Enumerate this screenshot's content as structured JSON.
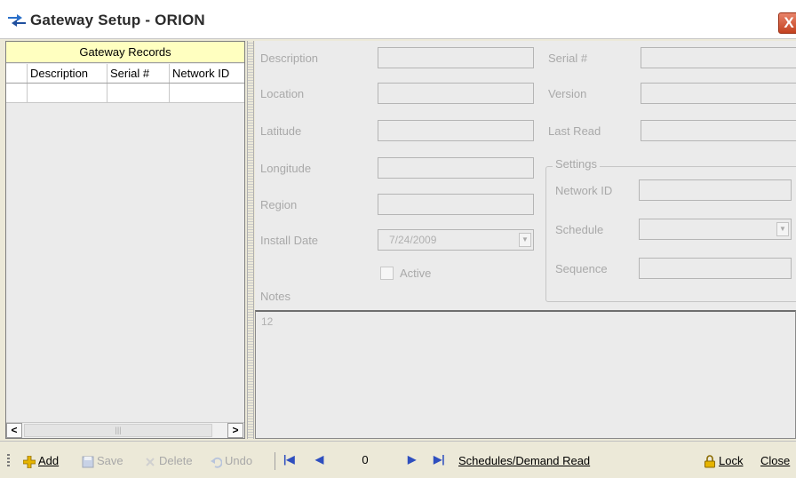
{
  "window": {
    "title": "Gateway Setup - ORION",
    "close_glyph": "X"
  },
  "records": {
    "title": "Gateway Records",
    "columns": [
      "Description",
      "Serial #",
      "Network ID"
    ],
    "scroll_left": "<",
    "scroll_right": ">"
  },
  "form": {
    "description_label": "Description",
    "location_label": "Location",
    "latitude_label": "Latitude",
    "longitude_label": "Longitude",
    "region_label": "Region",
    "install_date_label": "Install Date",
    "install_date_value": "7/24/2009",
    "active_label": "Active",
    "active_checked": false,
    "notes_label": "Notes",
    "notes_value": "12",
    "serial_label": "Serial #",
    "version_label": "Version",
    "last_read_label": "Last Read",
    "settings_label": "Settings",
    "network_id_label": "Network ID",
    "schedule_label": "Schedule",
    "sequence_label": "Sequence"
  },
  "toolbar": {
    "add": "Add",
    "save": "Save",
    "delete": "Delete",
    "undo": "Undo",
    "record_position": "0",
    "schedules": "Schedules/Demand Read",
    "lock": "Lock",
    "close": "Close"
  },
  "colors": {
    "records_header_bg": "#ffffc0",
    "nav_arrows": "#2f4fbf",
    "close_button": "#c3411f"
  },
  "icons": [
    "gateway-app-icon",
    "close-icon",
    "add-icon",
    "save-icon",
    "delete-icon",
    "undo-icon",
    "first-record-icon",
    "previous-record-icon",
    "next-record-icon",
    "last-record-icon",
    "lock-icon"
  ]
}
